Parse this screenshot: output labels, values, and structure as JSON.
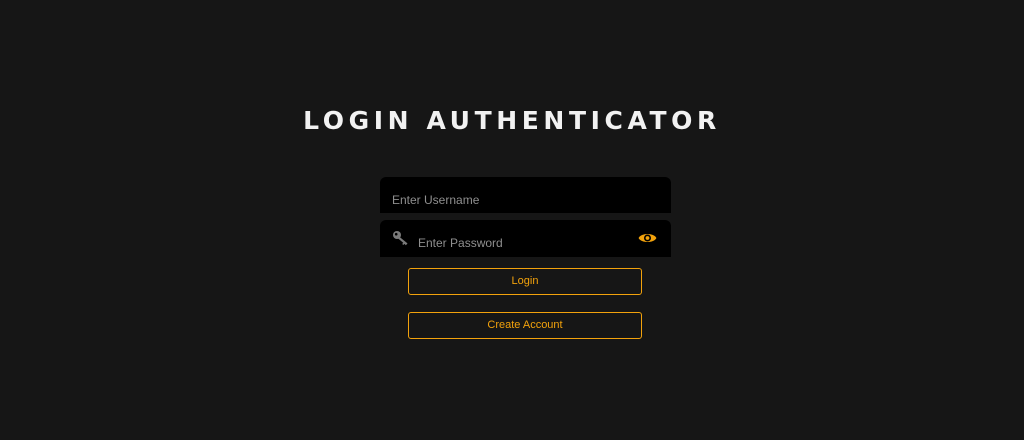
{
  "header": {
    "title": "LOGIN AUTHENTICATOR"
  },
  "form": {
    "username": {
      "placeholder": "Enter Username",
      "value": ""
    },
    "password": {
      "placeholder": "Enter Password",
      "value": "",
      "leading_icon": "key-icon",
      "toggle_icon": "eye-icon"
    },
    "login_label": "Login",
    "create_account_label": "Create Account"
  },
  "colors": {
    "background": "#161616",
    "field_background": "#000000",
    "accent": "#f2a20c",
    "title": "#f2f2f2",
    "placeholder": "#8f8f8f",
    "key_icon": "#7a7a7a"
  }
}
